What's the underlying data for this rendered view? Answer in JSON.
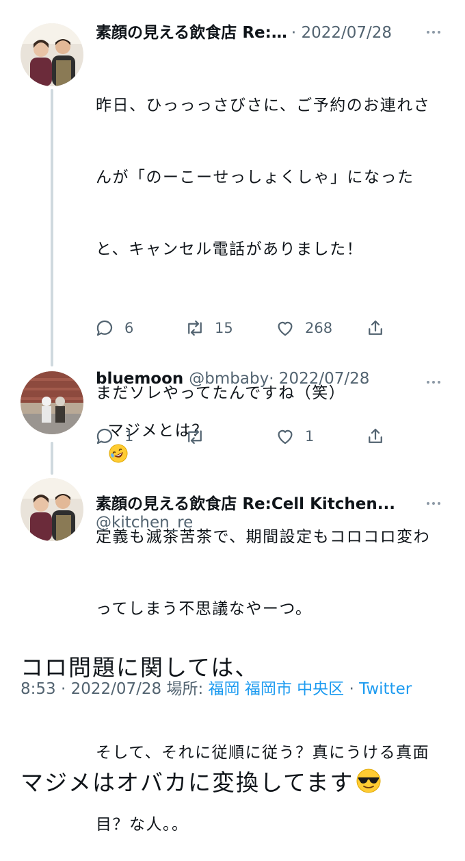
{
  "tweet1": {
    "name": "素顔の見える飲食店 Re:…",
    "date": "· 2022/07/28",
    "lines": [
      "昨日、ひっっっさびさに、ご予約のお連れさ",
      "んが「のーこーせっしょくしゃ」になった",
      "と、キャンセル電話がありました！",
      "",
      "まだソレやってたんですね（笑）",
      "",
      "定義も滅茶苦茶で、期間設定もコロコロ変わ",
      "ってしまう不思議なやーつ。",
      "",
      "そして、それに従順に従う？真にうける真面",
      "目？な人。。"
    ],
    "replies": "6",
    "retweets": "15",
    "likes": "268"
  },
  "tweet2": {
    "name": "bluemoon",
    "handle": "@bmbaby",
    "date": "· 2022/07/28",
    "text": "マジメとは？",
    "replies": "1",
    "retweets": "",
    "likes": "1"
  },
  "main": {
    "name": "素顔の見える飲食店 Re:Cell Kitchen...",
    "handle": "@kitchen_re",
    "line1": "コロ問題に関しては、",
    "line2": "マジメはオバカに変換してます"
  },
  "footer": {
    "time": "8:53 · 2022/07/28 場所: ",
    "place1": "福岡",
    "place2": "福岡市",
    "place3": "中央区",
    "sep": " · ",
    "client": "Twitter"
  },
  "icons": {
    "reply": "reply-icon",
    "retweet": "retweet-icon",
    "like": "heart-icon",
    "share": "share-icon",
    "more": "more-icon",
    "emoji1": "rofl-emoji-icon",
    "emoji2": "sunglasses-emoji-icon"
  },
  "colors": {
    "link": "#1d9bf0",
    "muted": "#536471",
    "text": "#0f1419",
    "thread_line": "#cfd9de"
  }
}
